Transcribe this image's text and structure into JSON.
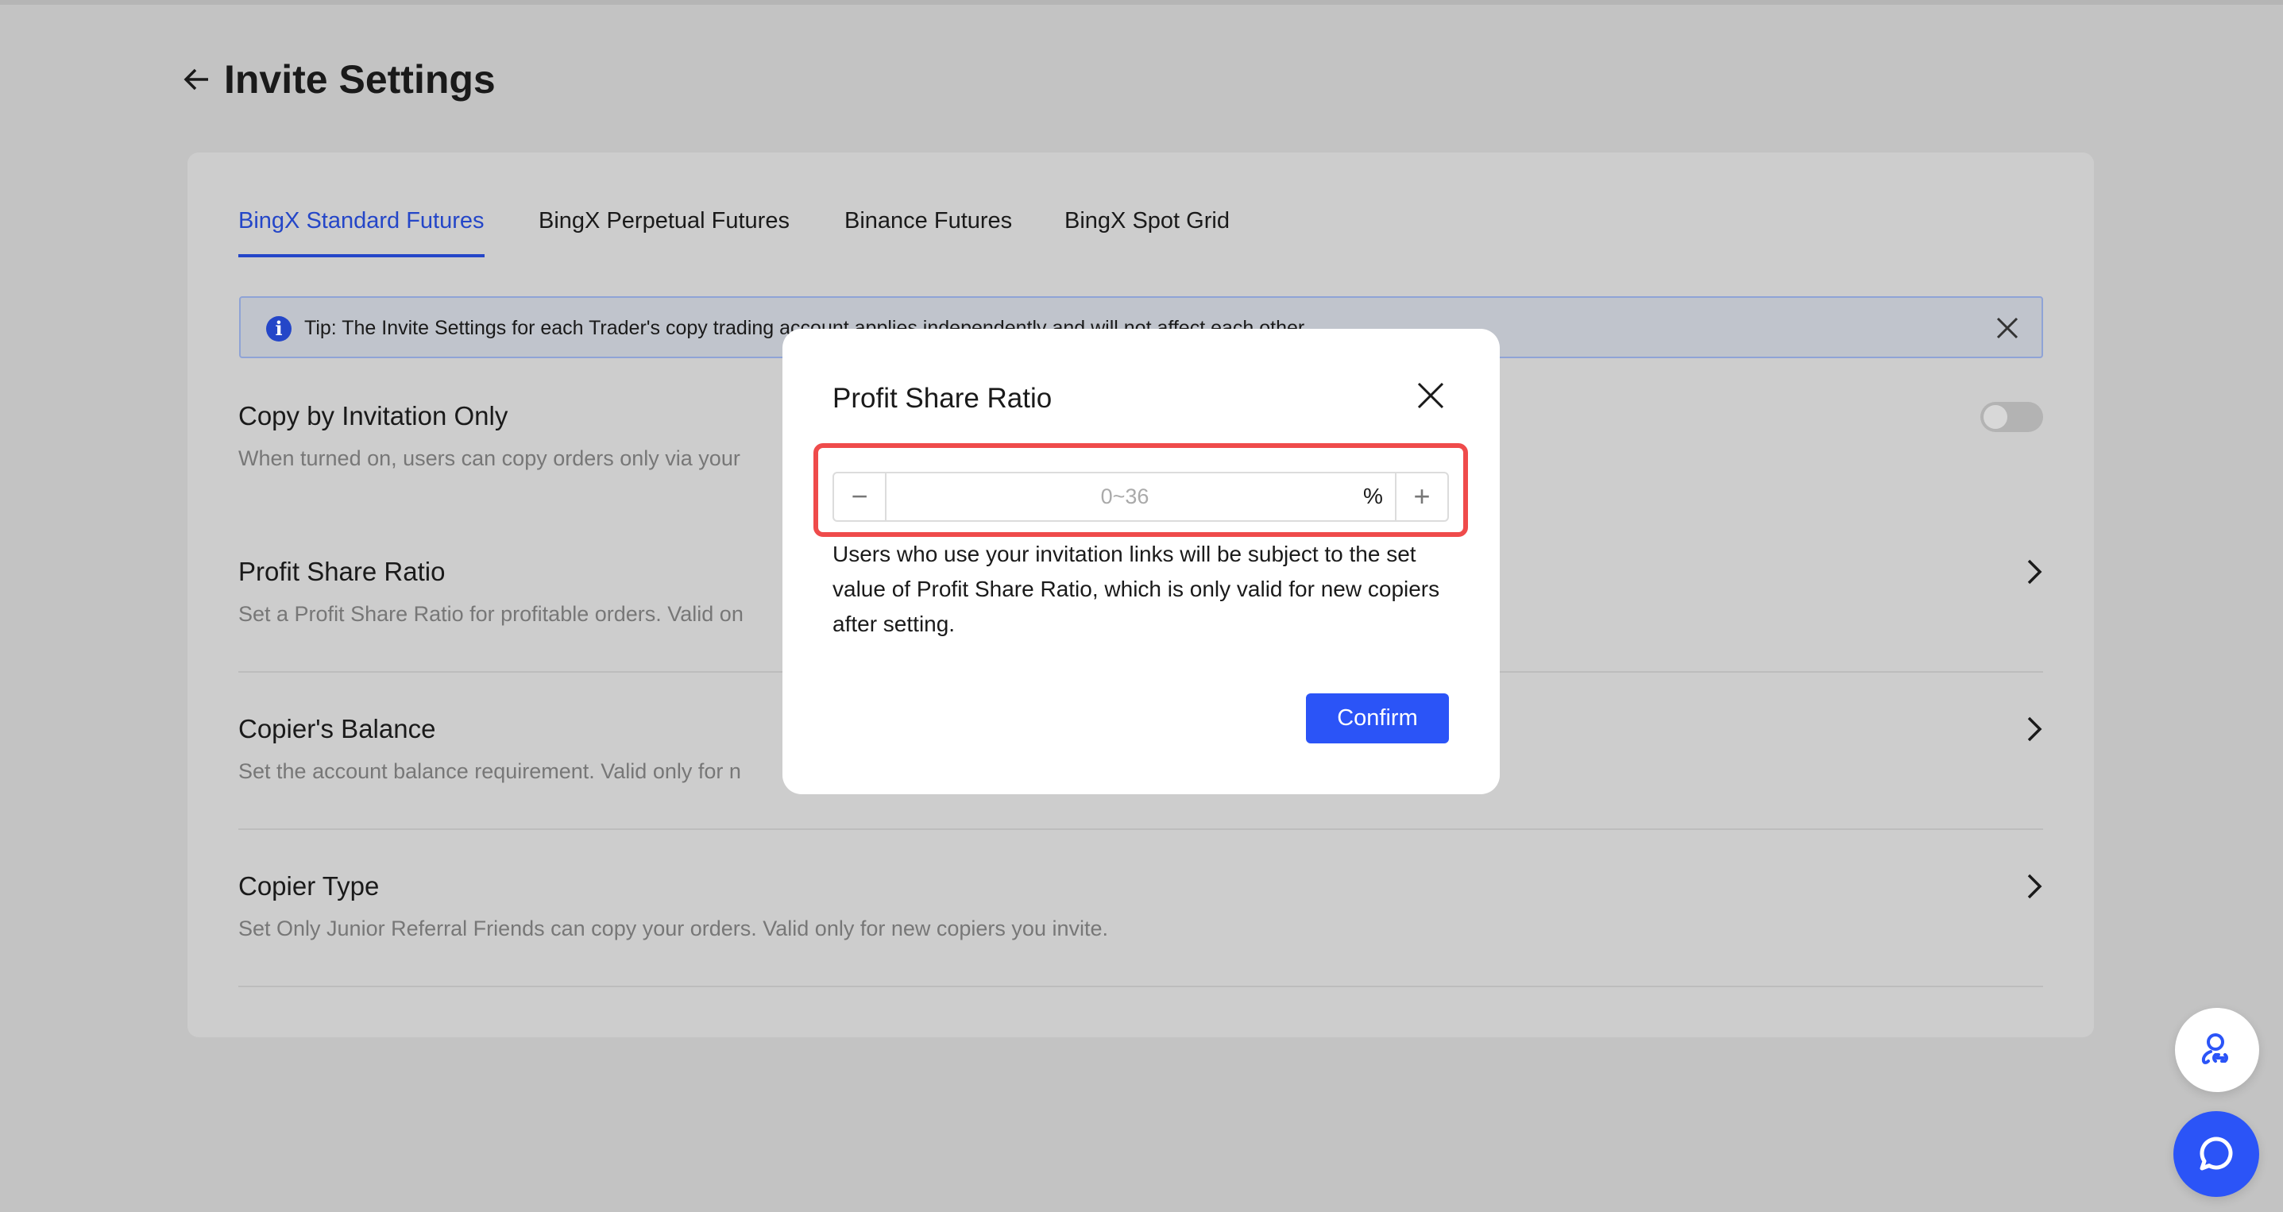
{
  "page": {
    "title": "Invite Settings",
    "back_icon": "arrow-left-icon"
  },
  "tabs": [
    {
      "label": "BingX Standard Futures",
      "active": true
    },
    {
      "label": "BingX Perpetual Futures",
      "active": false
    },
    {
      "label": "Binance Futures",
      "active": false
    },
    {
      "label": "BingX Spot Grid",
      "active": false
    }
  ],
  "tip": {
    "text": "Tip: The Invite Settings for each Trader's copy trading account applies independently and will not affect each other."
  },
  "settings": [
    {
      "title": "Copy by Invitation Only",
      "desc": "When turned on, users can copy orders only via your",
      "control": "toggle",
      "enabled": false
    },
    {
      "title": "Profit Share Ratio",
      "desc": "Set a Profit Share Ratio for profitable orders. Valid on",
      "control": "chevron"
    },
    {
      "title": "Copier's Balance",
      "desc": "Set the account balance requirement. Valid only for n",
      "control": "chevron"
    },
    {
      "title": "Copier Type",
      "desc": "Set Only Junior Referral Friends can copy your orders. Valid only for new copiers you invite.",
      "control": "chevron"
    }
  ],
  "modal": {
    "title": "Profit Share Ratio",
    "input": {
      "value": "",
      "placeholder": "0~36",
      "unit": "%",
      "minus": "−",
      "plus": "+"
    },
    "desc": "Users who use your invitation links will be subject to the set value of Profit Share Ratio, which is only valid for new copiers after setting.",
    "confirm_label": "Confirm"
  },
  "colors": {
    "accent": "#2b54f7",
    "highlight": "#ef4b4b",
    "active_tab": "#2446c8"
  }
}
